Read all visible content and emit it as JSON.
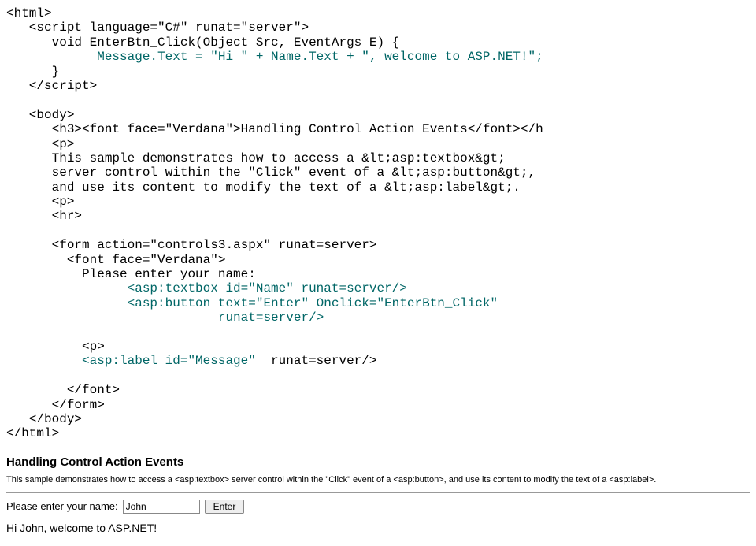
{
  "code": {
    "line1": "<html>",
    "line2": "   <script language=\"C#\" runat=\"server\">",
    "line3": "      void EnterBtn_Click(Object Src, EventArgs E) {",
    "line4a": "            ",
    "line4b": "Message.Text = \"Hi \" + Name.Text + \", welcome to ASP.NET!\";",
    "line5": "      }",
    "line6": "   </scr",
    "line6b": "ipt>",
    "line7": "   <body>",
    "line8": "      <h3><font face=\"Verdana\">Handling Control Action Events</font></h",
    "line9": "      <p>",
    "line10": "      This sample demonstrates how to access a &lt;asp:textbox&gt;",
    "line11": "      server control within the \"Click\" event of a &lt;asp:button&gt;,",
    "line12": "      and use its content to modify the text of a &lt;asp:label&gt;.",
    "line13": "      <p>",
    "line14": "      <hr>",
    "line15": "      <form action=\"controls3.aspx\" runat=server>",
    "line16": "        <font face=\"Verdana\">",
    "line17": "          Please enter your name:",
    "line18a": "                ",
    "line18b": "<asp:textbox id=\"Name\" runat=server/>",
    "line19a": "                ",
    "line19b": "<asp:button text=\"Enter\" Onclick=\"EnterBtn_Click\"",
    "line20a": "                            ",
    "line20b": "runat=server/>",
    "line21": "          <p>",
    "line22a": "          ",
    "line22b": "<asp:label id=\"Message\" ",
    "line22c": " runat=server/>",
    "line23": "        </font>",
    "line24": "      </form>",
    "line25": "   </body>",
    "line26": "</html>"
  },
  "heading": "Handling Control Action Events",
  "description": "This sample demonstrates how to access a <asp:textbox> server control within the \"Click\" event of a <asp:button>, and use its content to modify the text of a <asp:label>.",
  "form": {
    "label": "Please enter your name:",
    "value": "John",
    "button": "Enter"
  },
  "message": "Hi John, welcome to ASP.NET!"
}
